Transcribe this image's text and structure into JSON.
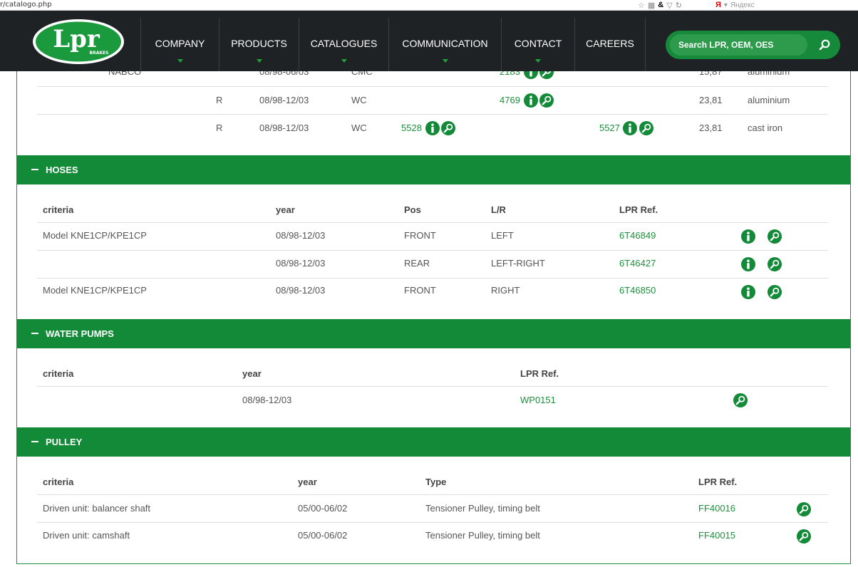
{
  "browser": {
    "url_fragment": "r/catalogo.php",
    "search_engine": "Яндекс",
    "search_engine_badge": "Я"
  },
  "nav": {
    "logo_text": "Lpr",
    "logo_sub": "BRAKES",
    "menu": [
      {
        "label": "COMPANY",
        "has_arrow": true
      },
      {
        "label": "PRODUCTS",
        "has_arrow": true
      },
      {
        "label": "CATALOGUES",
        "has_arrow": true
      },
      {
        "label": "COMMUNICATION",
        "has_arrow": true
      },
      {
        "label": "CONTACT",
        "has_arrow": true
      },
      {
        "label": "CAREERS",
        "has_arrow": false
      }
    ],
    "search_placeholder": "Search LPR, OEM, OES"
  },
  "top_table": {
    "rows": [
      {
        "brand": "NABCO",
        "side": "",
        "year": "08/98-06/03",
        "type": "CMC",
        "ref1": "",
        "ref2": "2183",
        "ref3": "",
        "value": "15,87",
        "material": "aluminium"
      },
      {
        "brand": "",
        "side": "R",
        "year": "08/98-12/03",
        "type": "WC",
        "ref1": "",
        "ref2": "4769",
        "ref3": "",
        "value": "23,81",
        "material": "aluminium"
      },
      {
        "brand": "",
        "side": "R",
        "year": "08/98-12/03",
        "type": "WC",
        "ref1": "5528",
        "ref2": "",
        "ref3": "5527",
        "value": "23,81",
        "material": "cast iron"
      }
    ]
  },
  "sections": {
    "hoses": {
      "title": "HOSES",
      "headers": {
        "criteria": "criteria",
        "year": "year",
        "pos": "Pos",
        "lr": "L/R",
        "ref": "LPR Ref."
      },
      "rows": [
        {
          "criteria": "Model KNE1CP/KPE1CP",
          "year": "08/98-12/03",
          "pos": "FRONT",
          "lr": "LEFT",
          "ref": "6T46849"
        },
        {
          "criteria": "",
          "year": "08/98-12/03",
          "pos": "REAR",
          "lr": "LEFT-RIGHT",
          "ref": "6T46427"
        },
        {
          "criteria": "Model KNE1CP/KPE1CP",
          "year": "08/98-12/03",
          "pos": "FRONT",
          "lr": "RIGHT",
          "ref": "6T46850"
        }
      ]
    },
    "water_pumps": {
      "title": "WATER PUMPS",
      "headers": {
        "criteria": "criteria",
        "year": "year",
        "ref": "LPR Ref."
      },
      "rows": [
        {
          "criteria": "",
          "year": "08/98-12/03",
          "ref": "WP0151"
        }
      ]
    },
    "pulley": {
      "title": "PULLEY",
      "headers": {
        "criteria": "criteria",
        "year": "year",
        "type": "Type",
        "ref": "LPR Ref."
      },
      "rows": [
        {
          "criteria": "Driven unit: balancer shaft",
          "year": "05/00-06/02",
          "type": "Tensioner Pulley, timing belt",
          "ref": "FF40016"
        },
        {
          "criteria": "Driven unit: camshaft",
          "year": "05/00-06/02",
          "type": "Tensioner Pulley, timing belt",
          "ref": "FF40015"
        }
      ]
    }
  },
  "colors": {
    "brand_green": "#128a38",
    "nav_bg": "#1e2224",
    "link_green": "#1e8f3c"
  }
}
